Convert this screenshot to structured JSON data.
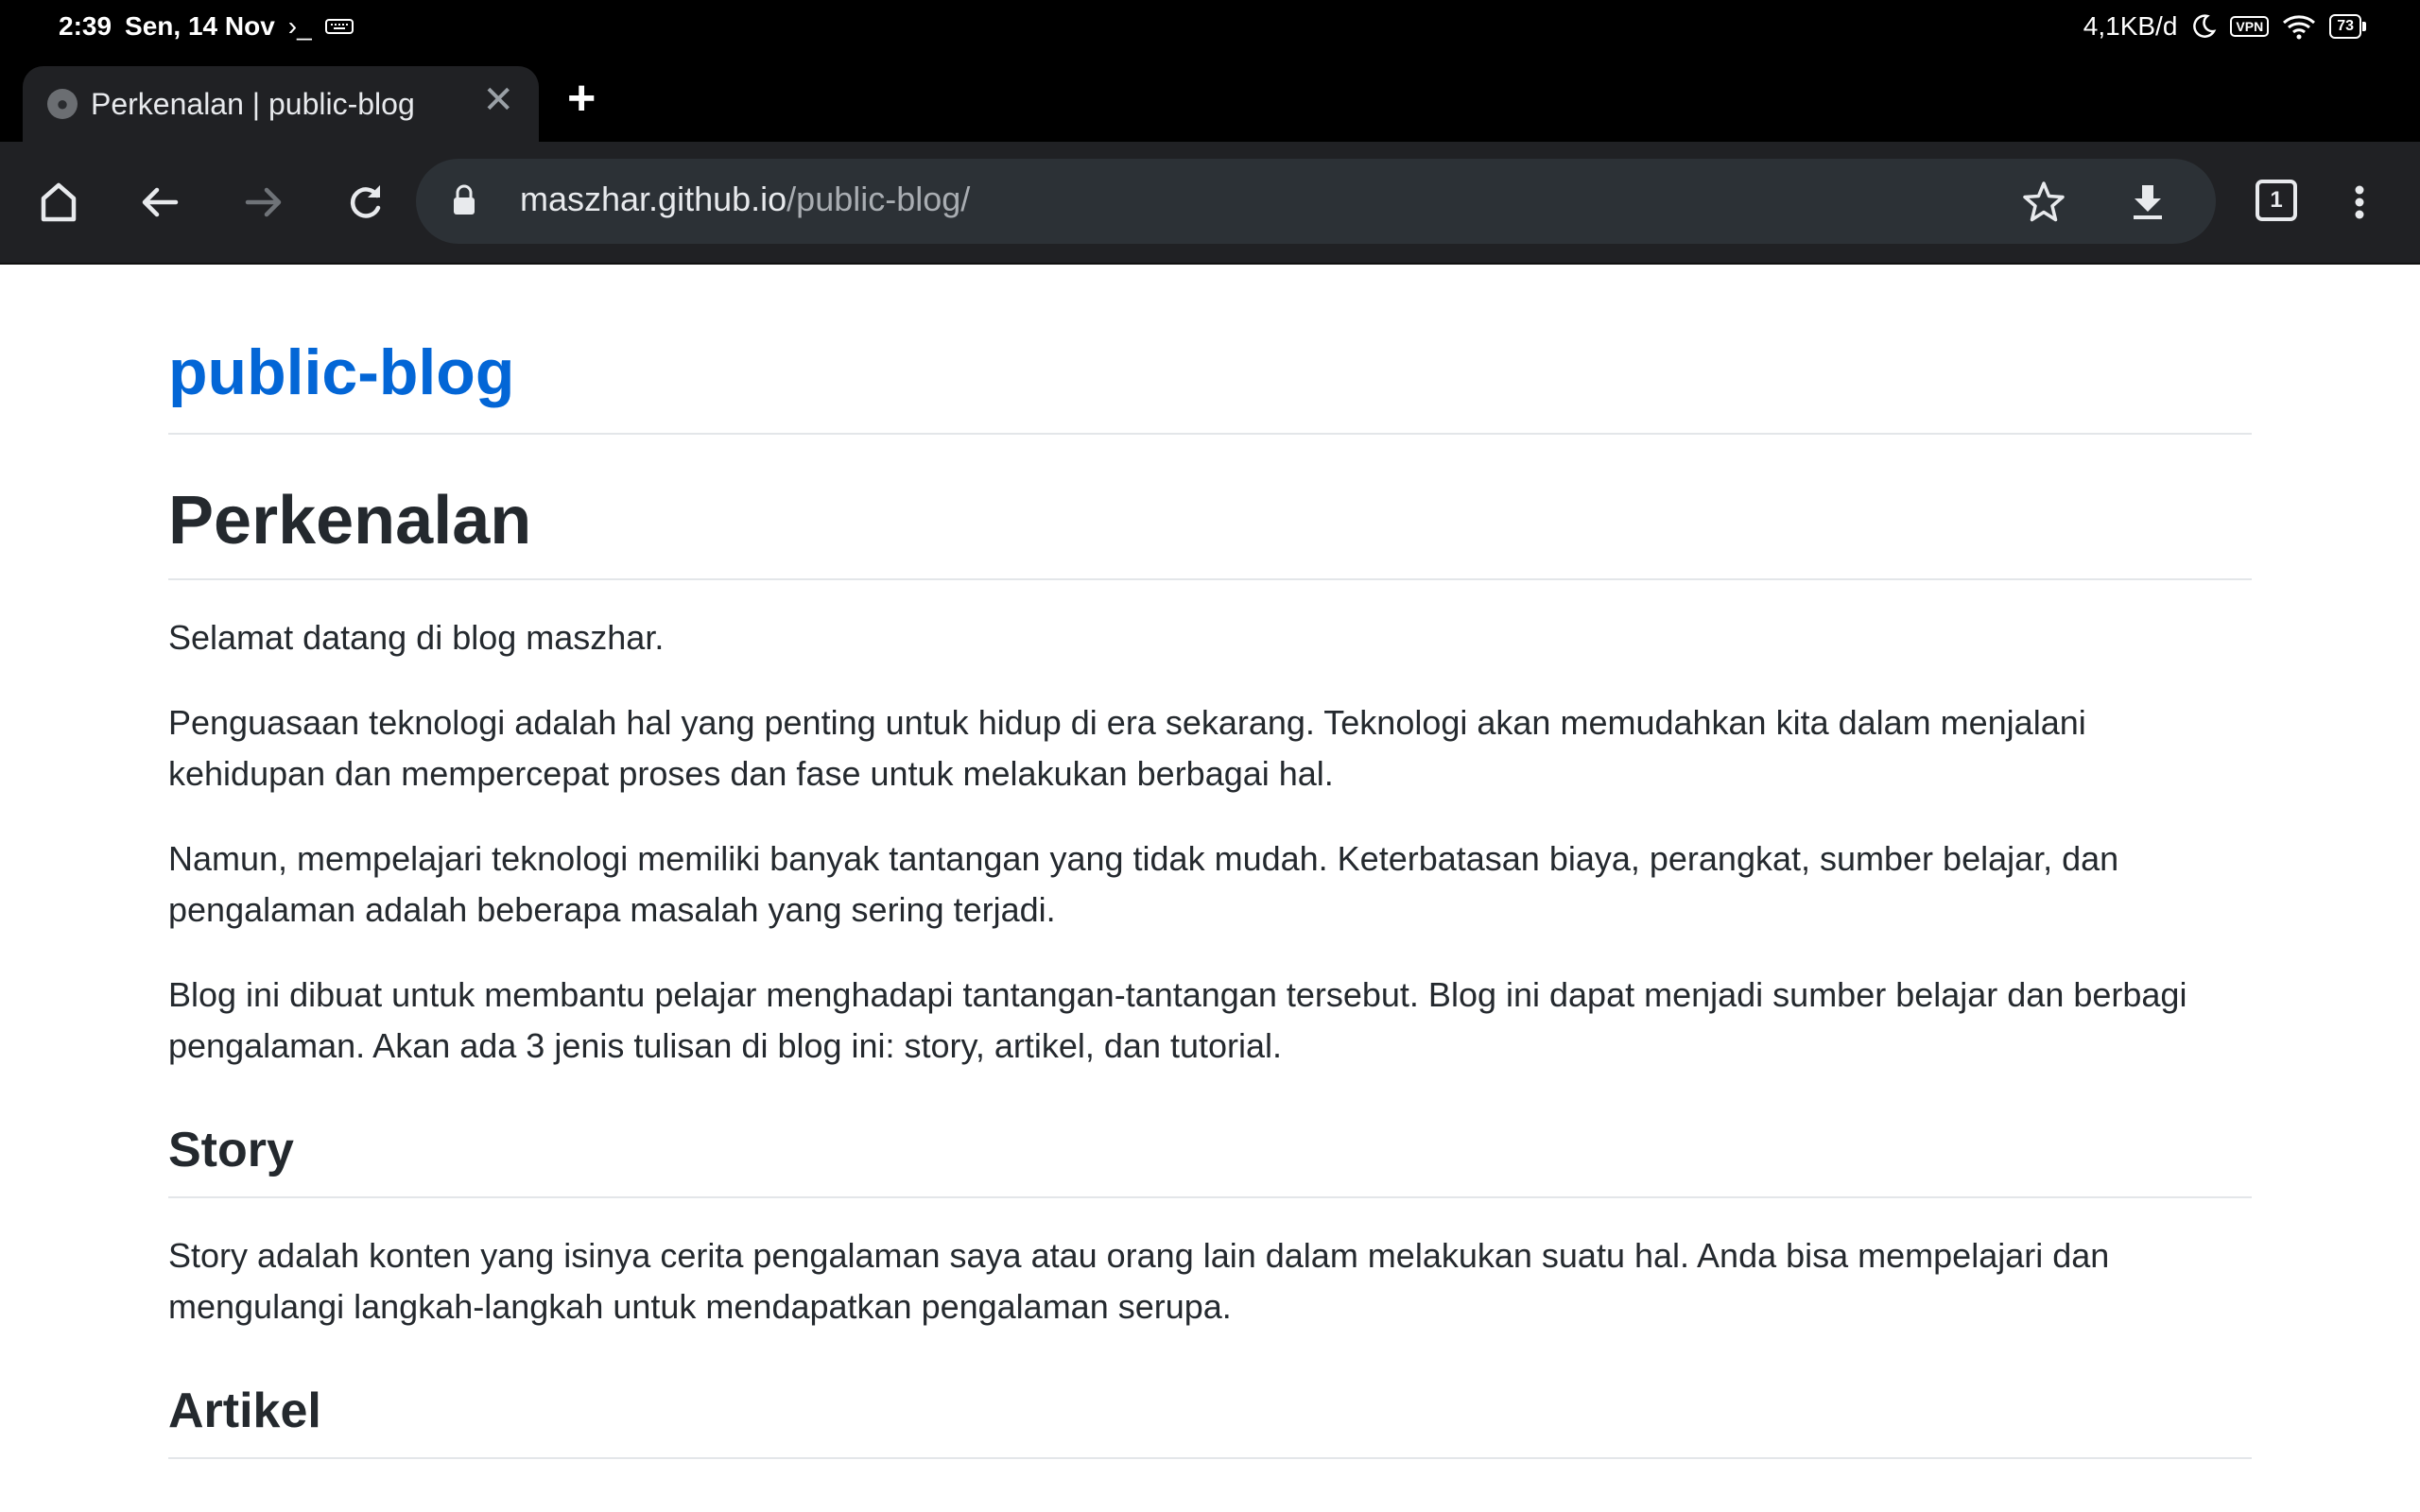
{
  "status_bar": {
    "time": "2:39",
    "date": "Sen, 14 Nov",
    "network_speed": "4,1KB/d",
    "vpn_label": "VPN",
    "battery": "73"
  },
  "tab": {
    "title": "Perkenalan | public-blog"
  },
  "omnibox": {
    "url_host": "maszhar.github.io",
    "url_path": "/public-blog/",
    "tab_count": "1"
  },
  "page": {
    "site_title": "public-blog",
    "heading": "Perkenalan",
    "paragraphs": [
      "Selamat datang di blog maszhar.",
      "Penguasaan teknologi adalah hal yang penting untuk hidup di era sekarang. Teknologi akan memudahkan kita dalam menjalani kehidupan dan mempercepat proses dan fase untuk melakukan berbagai hal.",
      "Namun, mempelajari teknologi memiliki banyak tantangan yang tidak mudah. Keterbatasan biaya, perangkat, sumber belajar, dan pengalaman adalah beberapa masalah yang sering terjadi.",
      "Blog ini dibuat untuk membantu pelajar menghadapi tantangan-tantangan tersebut. Blog ini dapat menjadi sumber belajar dan berbagi pengalaman. Akan ada 3 jenis tulisan di blog ini: story, artikel, dan tutorial."
    ],
    "sections": [
      {
        "heading": "Story",
        "paragraph": "Story adalah konten yang isinya cerita pengalaman saya atau orang lain dalam melakukan suatu hal. Anda bisa mempelajari dan mengulangi langkah-langkah untuk mendapatkan pengalaman serupa."
      },
      {
        "heading": "Artikel"
      }
    ]
  },
  "colors": {
    "link": "#0366d6",
    "text": "#24292e",
    "toolbar": "#202124",
    "omnibox": "#2c3136"
  },
  "icons": {
    "toolbar": [
      "home-icon",
      "back-icon",
      "forward-icon",
      "reload-icon",
      "lock-icon",
      "star-icon",
      "download-icon",
      "tab-switcher-icon",
      "more-options-icon"
    ],
    "status_bar": [
      "terminal-icon",
      "keyboard-icon",
      "moon-icon",
      "vpn-icon",
      "wifi-icon",
      "battery-icon"
    ]
  }
}
